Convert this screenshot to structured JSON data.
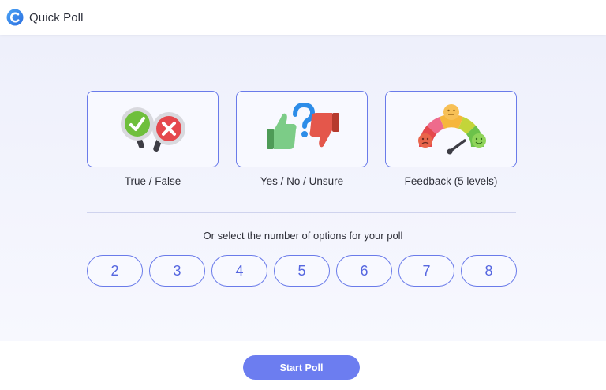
{
  "app": {
    "title": "Quick Poll",
    "logo_icon": "quickpoll-logo-icon"
  },
  "poll_types": [
    {
      "label": "True / False",
      "icon": "true-false-icon"
    },
    {
      "label": "Yes / No / Unsure",
      "icon": "yes-no-unsure-icon"
    },
    {
      "label": "Feedback (5 levels)",
      "icon": "feedback-gauge-icon"
    }
  ],
  "options": {
    "prompt": "Or select the number of options for your poll",
    "values": [
      "2",
      "3",
      "4",
      "5",
      "6",
      "7",
      "8"
    ]
  },
  "footer": {
    "start_label": "Start Poll"
  },
  "colors": {
    "accent": "#6a7bea",
    "button": "#6c7df0",
    "background_top": "#eef0fb"
  }
}
